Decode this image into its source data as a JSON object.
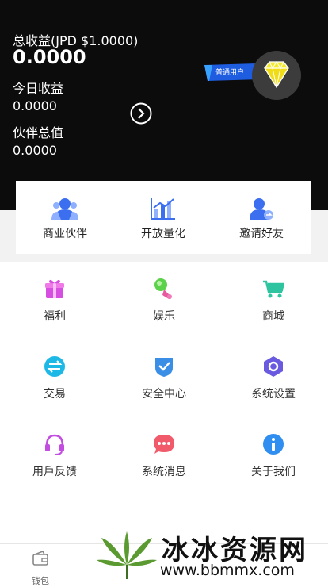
{
  "header": {
    "total_label": "总收益(JPD $1.0000)",
    "total_value": "0.0000",
    "today_label": "今日收益",
    "today_value": "0.0000",
    "partner_label": "伙伴总值",
    "partner_value": "0.0000",
    "user_level": "普通用户"
  },
  "quick_actions": [
    {
      "label": "商业伙伴",
      "icon": "partner-icon"
    },
    {
      "label": "开放量化",
      "icon": "chart-icon"
    },
    {
      "label": "邀请好友",
      "icon": "invite-icon"
    }
  ],
  "menu": [
    {
      "label": "福利",
      "icon": "gift-icon",
      "color": "#e04bd8"
    },
    {
      "label": "娱乐",
      "icon": "joystick-icon",
      "color": "#5cd14a"
    },
    {
      "label": "商城",
      "icon": "cart-icon",
      "color": "#2fc4a0"
    },
    {
      "label": "交易",
      "icon": "exchange-icon",
      "color": "#1eb8e6"
    },
    {
      "label": "安全中心",
      "icon": "shield-icon",
      "color": "#3a8ee6"
    },
    {
      "label": "系统设置",
      "icon": "settings-icon",
      "color": "#6a5ae0"
    },
    {
      "label": "用戶反馈",
      "icon": "headset-icon",
      "color": "#c24de0"
    },
    {
      "label": "系统消息",
      "icon": "message-icon",
      "color": "#f05a6a"
    },
    {
      "label": "关于我们",
      "icon": "info-icon",
      "color": "#2f8ef0"
    }
  ],
  "tabbar": {
    "wallet_label": "钱包"
  },
  "watermark": {
    "text": "冰冰资源网",
    "url": "www.bbmmx.com"
  }
}
